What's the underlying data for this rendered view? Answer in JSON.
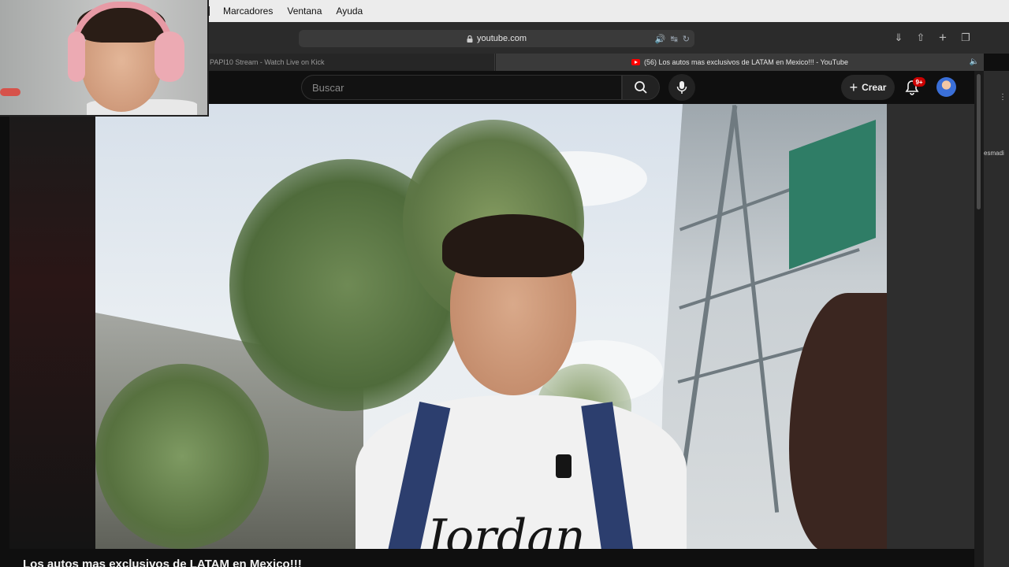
{
  "menu": {
    "items": [
      "Marcadores",
      "Ventana",
      "Ayuda"
    ]
  },
  "browser": {
    "url": "youtube.com"
  },
  "tabs": [
    {
      "title": "PAPI10 Stream - Watch Live on Kick",
      "active": false
    },
    {
      "title": "(56) Los autos mas exclusivos de LATAM en Mexico!!! - YouTube",
      "active": true
    }
  ],
  "youtube": {
    "search_placeholder": "Buscar",
    "create_label": "Crear",
    "notifications_badge": "9+",
    "video_title": "Los autos mas exclusivos de LATAM en Mexico!!!",
    "shirt_text": "Jordan"
  },
  "side": {
    "truncated_text": "esmadi"
  },
  "colors": {
    "brand": "#ff0000",
    "badge": "#cc0000",
    "background": "#0f0f0f"
  }
}
